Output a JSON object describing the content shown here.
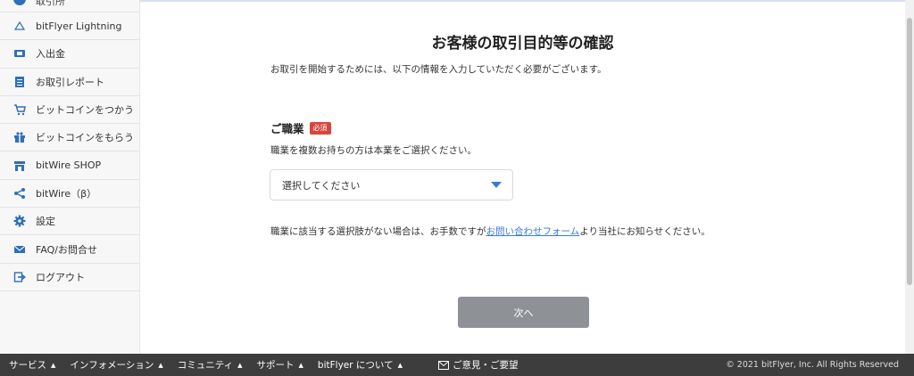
{
  "sidebar": {
    "top_partial_label": "取引所",
    "items": [
      {
        "label": "bitFlyer Lightning",
        "icon": "lightning-triangle-icon"
      },
      {
        "label": "入出金",
        "icon": "deposit-withdraw-icon"
      },
      {
        "label": "お取引レポート",
        "icon": "report-icon"
      },
      {
        "label": "ビットコインをつかう",
        "icon": "cart-icon"
      },
      {
        "label": "ビットコインをもらう",
        "icon": "gift-icon"
      },
      {
        "label": "bitWire SHOP",
        "icon": "shop-icon"
      },
      {
        "label": "bitWire（β）",
        "icon": "share-icon"
      },
      {
        "label": "設定",
        "icon": "gear-icon"
      },
      {
        "label": "FAQ/お問合せ",
        "icon": "mail-icon"
      },
      {
        "label": "ログアウト",
        "icon": "logout-icon"
      }
    ]
  },
  "main": {
    "title": "お客様の取引目的等の確認",
    "intro": "お取引を開始するためには、以下の情報を入力していただく必要がございます。",
    "occupation": {
      "label": "ご職業",
      "required_badge": "必須",
      "help": "職業を複数お持ちの方は本業をご選択ください。",
      "select_value": "選択してください"
    },
    "note_before": "職業に該当する選択肢がない場合は、お手数ですが",
    "note_link": "お問い合わせフォーム",
    "note_after": "より当社にお知らせください。",
    "next_button": "次へ"
  },
  "footer": {
    "menu": [
      {
        "label": "サービス"
      },
      {
        "label": "インフォメーション"
      },
      {
        "label": "コミュニティ"
      },
      {
        "label": "サポート"
      },
      {
        "label": "bitFlyer について"
      }
    ],
    "menu_arrow": "▲",
    "feedback": "ご意見・ご要望",
    "copyright": "© 2021 bitFlyer, Inc. All Rights Reserved"
  },
  "colors": {
    "accent_blue": "#3a7bd5",
    "required_red": "#d9453b",
    "button_gray": "#8e9297",
    "footer_bg": "#3d3d3d"
  }
}
